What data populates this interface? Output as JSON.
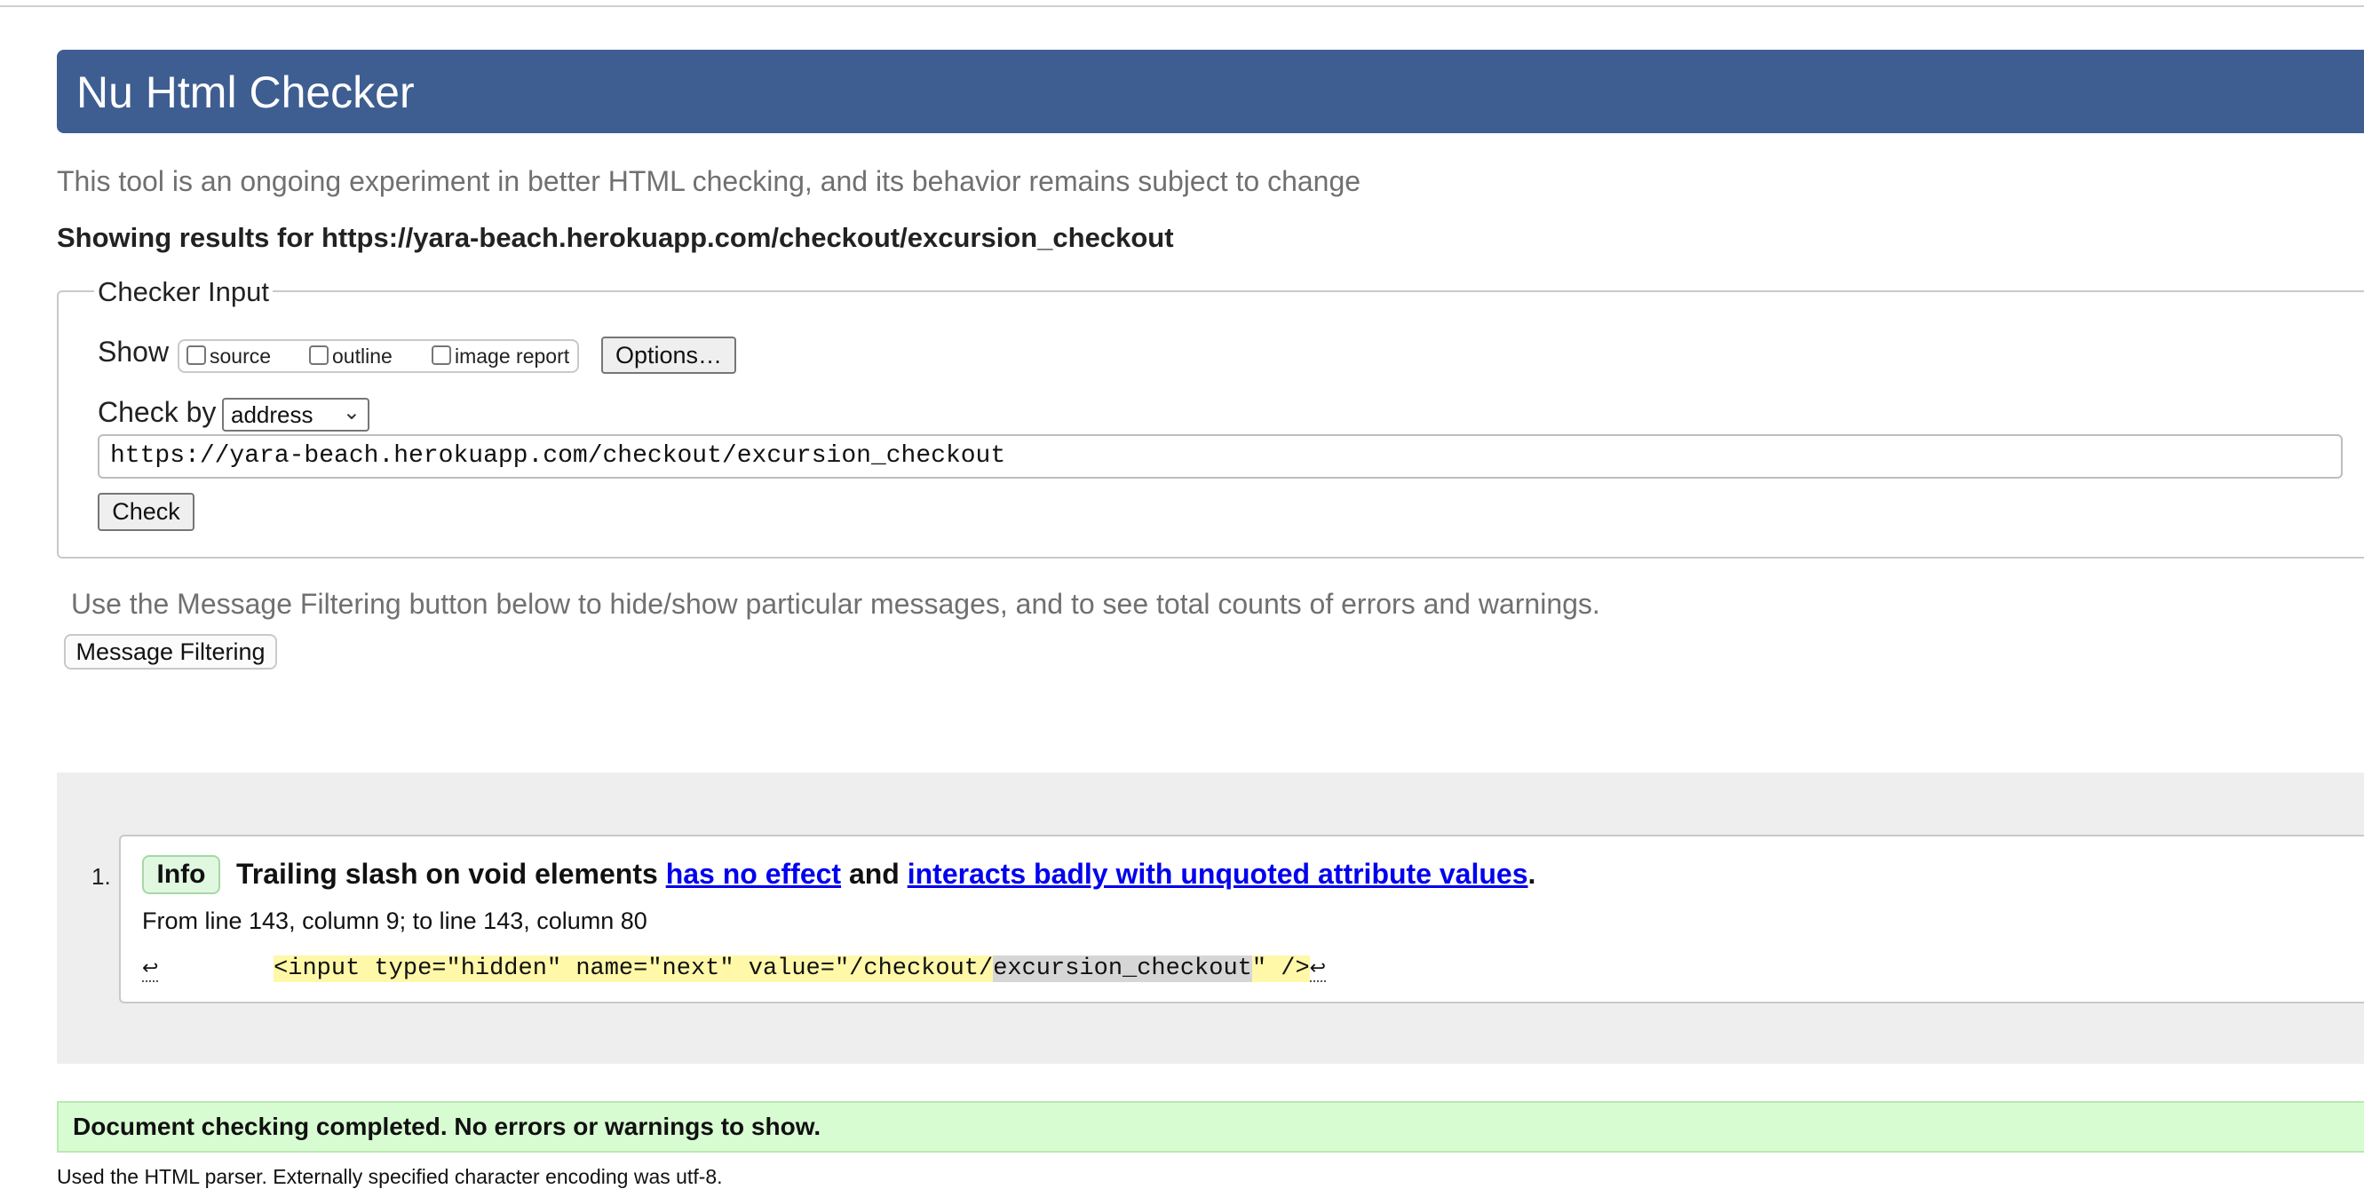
{
  "header": {
    "title": "Nu Html Checker",
    "tagline": "This tool is an ongoing experiment in better HTML checking, and its behavior remains subject to change",
    "showing_results": "Showing results for https://yara-beach.herokuapp.com/checkout/excursion_checkout"
  },
  "checker_input": {
    "legend": "Checker Input",
    "show_label": "Show",
    "options": [
      {
        "label": "source",
        "checked": false
      },
      {
        "label": "outline",
        "checked": false
      },
      {
        "label": "image report",
        "checked": false
      }
    ],
    "options_button": "Options…",
    "check_by_label": "Check by",
    "check_by_value": "address",
    "url_value": "https://yara-beach.herokuapp.com/checkout/excursion_checkout",
    "check_button": "Check"
  },
  "filtering": {
    "hint": "Use the Message Filtering button below to hide/show particular messages, and to see total counts of errors and warnings.",
    "button": "Message Filtering"
  },
  "messages": [
    {
      "number": "1.",
      "type": "Info",
      "text_before": "Trailing slash on void elements ",
      "link1": "has no effect",
      "text_middle": " and ",
      "link2": "interacts badly with unquoted attribute values",
      "text_after": ".",
      "location": "From line 143, column 9; to line 143, column 80",
      "extract_pre": "        ",
      "extract_hl_start": "<input type=\"hidden\" name=\"next\" value=\"/checkout/",
      "extract_hl_err": "excursion_checkout",
      "extract_hl_end": "\" />",
      "line_feed_glyph": "↩"
    }
  ],
  "status": {
    "complete": "Document checking completed. No errors or warnings to show.",
    "parser_note": "Used the HTML parser. Externally specified character encoding was utf-8."
  },
  "colors": {
    "banner": "#3e5e92",
    "info_badge_bg": "#e0f8e0",
    "success_bg": "#d8fcd2",
    "link": "#0000ee",
    "highlight": "#fff8a8"
  }
}
